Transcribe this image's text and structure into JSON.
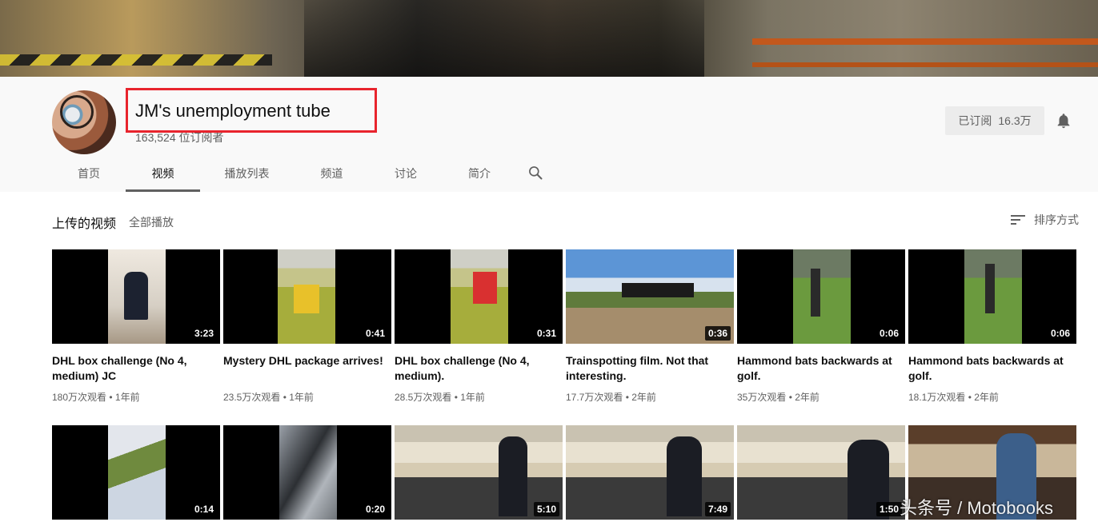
{
  "channel": {
    "title": "JM's unemployment tube",
    "subscribers_text": "163,524 位订阅者",
    "subscribe_label": "已订阅",
    "subscribe_count": "16.3万"
  },
  "tabs": [
    {
      "label": "首页"
    },
    {
      "label": "视频"
    },
    {
      "label": "播放列表"
    },
    {
      "label": "频道"
    },
    {
      "label": "讨论"
    },
    {
      "label": "简介"
    }
  ],
  "active_tab": "视频",
  "section": {
    "title": "上传的视频",
    "play_all": "全部播放",
    "sort_label": "排序方式"
  },
  "videos_row1": [
    {
      "title": "DHL box challenge (No 4, medium) JC",
      "duration": "3:23",
      "views": "180万次观看",
      "age": "1年前"
    },
    {
      "title": "Mystery DHL package arrives!",
      "duration": "0:41",
      "views": "23.5万次观看",
      "age": "1年前"
    },
    {
      "title": "DHL box challenge (No 4, medium).",
      "duration": "0:31",
      "views": "28.5万次观看",
      "age": "1年前"
    },
    {
      "title": "Trainspotting film. Not that interesting.",
      "duration": "0:36",
      "views": "17.7万次观看",
      "age": "2年前"
    },
    {
      "title": "Hammond bats backwards at golf.",
      "duration": "0:06",
      "views": "35万次观看",
      "age": "2年前"
    },
    {
      "title": "Hammond bats backwards at golf.",
      "duration": "0:06",
      "views": "18.1万次观看",
      "age": "2年前"
    }
  ],
  "videos_row2": [
    {
      "duration": "0:14"
    },
    {
      "duration": "0:20"
    },
    {
      "duration": "5:10"
    },
    {
      "duration": "7:49"
    },
    {
      "duration": "1:50"
    },
    {
      "duration": ""
    }
  ],
  "meta_separator": "•",
  "watermark": "头条号 / Motobooks",
  "colors": {
    "highlight": "#e8242d",
    "text": "#0f0f0f",
    "secondary": "#606060"
  }
}
